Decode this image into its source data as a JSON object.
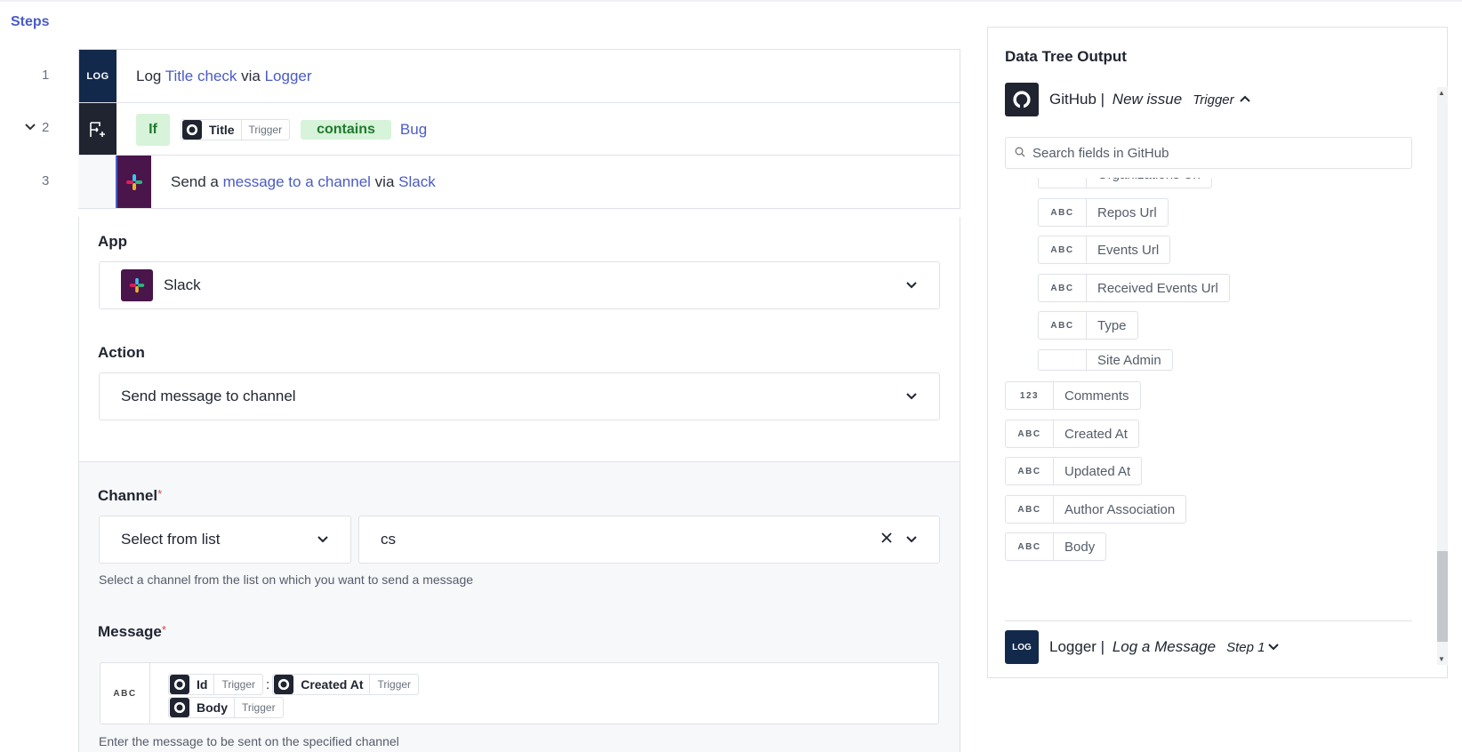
{
  "steps_title": "Steps",
  "steps": [
    {
      "num": "1",
      "tile": "LOG",
      "prefix": "Log ",
      "action": "Title check",
      "via": " via ",
      "app": "Logger"
    },
    {
      "num": "2",
      "if_label": "If",
      "field": "Title",
      "field_source": "Trigger",
      "operator": "contains",
      "value": "Bug"
    },
    {
      "num": "3",
      "prefix": "Send a ",
      "action": "message to a channel",
      "via": " via ",
      "app": "Slack"
    }
  ],
  "form": {
    "app_label": "App",
    "app_value": "Slack",
    "action_label": "Action",
    "action_value": "Send message to channel",
    "channel_label": "Channel",
    "channel_required": "*",
    "channel_mode": "Select from list",
    "channel_value": "cs",
    "channel_help": "Select a channel from the list on which you want to send a message",
    "message_label": "Message",
    "message_required": "*",
    "message_type": "ABC",
    "message_tokens_line1": [
      {
        "label": "Id",
        "source": "Trigger"
      },
      {
        "label": "Created At",
        "source": "Trigger"
      }
    ],
    "message_separator": ":",
    "message_tokens_line2": [
      {
        "label": "Body",
        "source": "Trigger"
      }
    ],
    "message_help": "Enter the message to be sent on the specified channel"
  },
  "data_tree": {
    "title": "Data Tree Output",
    "github": {
      "name": "GitHub",
      "sep": " | ",
      "event": "New issue",
      "tag": "Trigger"
    },
    "search_placeholder": "Search fields in GitHub",
    "fields": [
      {
        "type": "ABC",
        "name": "Organizations Url"
      },
      {
        "type": "ABC",
        "name": "Repos Url"
      },
      {
        "type": "ABC",
        "name": "Events Url"
      },
      {
        "type": "ABC",
        "name": "Received Events Url"
      },
      {
        "type": "ABC",
        "name": "Type"
      },
      {
        "type": "",
        "name": "Site Admin"
      },
      {
        "type": "123",
        "name": "Comments"
      },
      {
        "type": "ABC",
        "name": "Created At"
      },
      {
        "type": "ABC",
        "name": "Updated At"
      },
      {
        "type": "ABC",
        "name": "Author Association"
      },
      {
        "type": "ABC",
        "name": "Body"
      }
    ],
    "logger": {
      "tile": "LOG",
      "name": "Logger",
      "sep": " | ",
      "event": "Log a Message",
      "tag": "Step 1"
    }
  },
  "colors": {
    "accent": "#4a5bc7",
    "slack": "#4a154b",
    "logger": "#13294b",
    "green_bg": "#d7f3d9",
    "green_text": "#1e7a2d"
  }
}
